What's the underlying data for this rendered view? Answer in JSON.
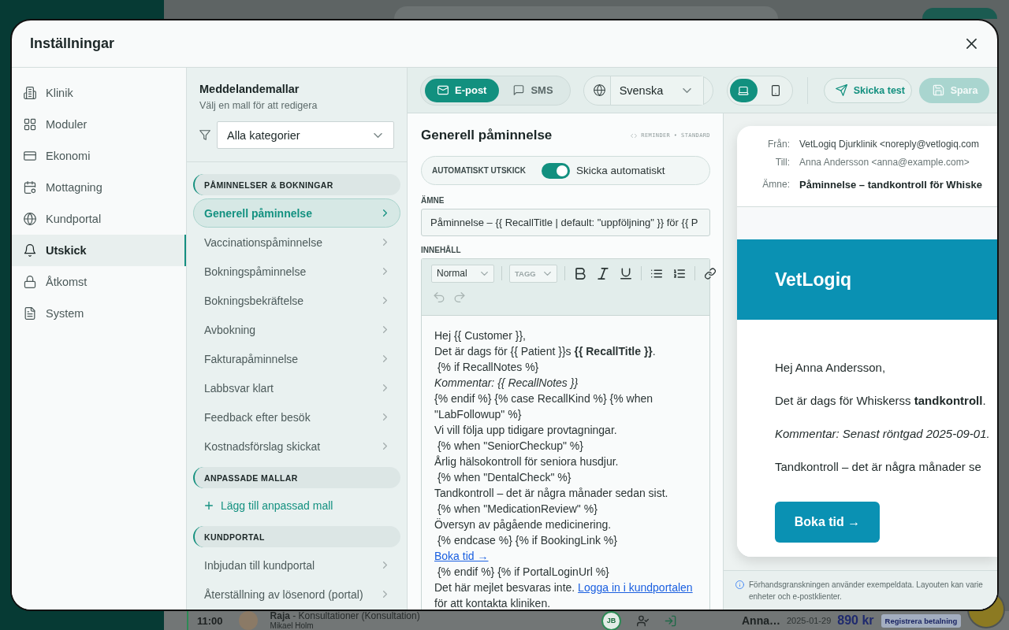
{
  "background": {
    "appointment": {
      "time": "11:00",
      "title": "**Raja** - Konsultationer (Konsultation)",
      "vet": "Mikael Holm",
      "initials": "JB"
    },
    "invoice": {
      "customer": "Anna…",
      "date": "2025-01-29",
      "amount": "890 kr",
      "action": "Registrera betalning"
    }
  },
  "dialog": {
    "title": "Inställningar"
  },
  "nav": {
    "items": [
      {
        "label": "Klinik",
        "selected": false
      },
      {
        "label": "Moduler",
        "selected": false
      },
      {
        "label": "Ekonomi",
        "selected": false
      },
      {
        "label": "Mottagning",
        "selected": false
      },
      {
        "label": "Kundportal",
        "selected": false
      },
      {
        "label": "Utskick",
        "selected": true
      },
      {
        "label": "Åtkomst",
        "selected": false
      },
      {
        "label": "System",
        "selected": false
      }
    ]
  },
  "templates": {
    "title": "Meddelandemallar",
    "subtitle": "Välj en mall för att redigera",
    "filter": {
      "value": "Alla kategorier"
    },
    "groups": [
      {
        "title": "PÅMINNELSER & BOKNINGAR",
        "items": [
          {
            "label": "Generell påminnelse",
            "selected": true
          },
          {
            "label": "Vaccinationspåminnelse",
            "selected": false
          },
          {
            "label": "Bokningspåminnelse",
            "selected": false
          },
          {
            "label": "Bokningsbekräftelse",
            "selected": false
          },
          {
            "label": "Avbokning",
            "selected": false
          },
          {
            "label": "Fakturapåminnelse",
            "selected": false
          },
          {
            "label": "Labbsvar klart",
            "selected": false
          },
          {
            "label": "Feedback efter besök",
            "selected": false
          },
          {
            "label": "Kostnadsförslag skickat",
            "selected": false
          }
        ]
      },
      {
        "title": "ANPASSADE MALLAR",
        "add_label": "Lägg till anpassad mall"
      },
      {
        "title": "KUNDPORTAL",
        "items": [
          {
            "label": "Inbjudan till kundportal",
            "selected": false
          },
          {
            "label": "Återställning av lösenord (portal)",
            "selected": false
          }
        ]
      }
    ]
  },
  "toolbar": {
    "channels": [
      {
        "label": "E-post",
        "selected": true
      },
      {
        "label": "SMS",
        "selected": false
      }
    ],
    "language": {
      "value": "Svenska"
    },
    "devices": [
      {
        "selected": true
      },
      {
        "selected": false
      }
    ],
    "actions": [
      {
        "kind": "test",
        "label": "Skicka test",
        "disabled": false
      },
      {
        "kind": "save",
        "label": "Spara",
        "disabled": true
      }
    ]
  },
  "editor": {
    "title": "Generell påminnelse",
    "meta": "REMINDER • STANDARD",
    "auto_send": {
      "label": "AUTOMATISKT UTSKICK",
      "toggle_label": "Skicka automatiskt",
      "on": true
    },
    "subject": {
      "label": "ÄMNE",
      "value": "Påminnelse – {{ RecallTitle | default: \"uppföljning\" }} för {{ P"
    },
    "content": {
      "label": "INNEHÅLL",
      "format": "Normal",
      "tag_placeholder": "TAGG",
      "undo_disabled": true,
      "redo_disabled": true,
      "lines": [
        {
          "kind": "text",
          "text": "Hej {{ Customer }},"
        },
        {
          "kind": "text",
          "text": "Det är dags för {{ Patient }}s **{{ RecallTitle }}**."
        },
        {
          "kind": "text",
          "text": " {% if RecallNotes %}"
        },
        {
          "kind": "italic",
          "text": "Kommentar: {{ RecallNotes }}"
        },
        {
          "kind": "text",
          "text": "{% endif %} {% case RecallKind %} {% when \"LabFollowup\" %}"
        },
        {
          "kind": "text",
          "text": "Vi vill följa upp tidigare provtagningar."
        },
        {
          "kind": "text",
          "text": " {% when \"SeniorCheckup\" %}"
        },
        {
          "kind": "text",
          "text": "Årlig hälsokontroll för seniora husdjur."
        },
        {
          "kind": "text",
          "text": " {% when \"DentalCheck\" %}"
        },
        {
          "kind": "text",
          "text": "Tandkontroll – det är några månader sedan sist."
        },
        {
          "kind": "text",
          "text": " {% when \"MedicationReview\" %}"
        },
        {
          "kind": "text",
          "text": "Översyn av pågående medicinering."
        },
        {
          "kind": "text",
          "text": " {% endcase %} {% if BookingLink %}"
        },
        {
          "kind": "link",
          "text": "Boka tid →"
        },
        {
          "kind": "text",
          "text": " {% endif %} {% if PortalLoginUrl %}"
        },
        {
          "kind": "linked",
          "before": "Det här mejlet besvaras inte.",
          "link": "Logga in i kundportalen",
          "after": "för att kontakta kliniken."
        }
      ]
    }
  },
  "preview": {
    "fields": [
      {
        "kind": "from",
        "label": "Från:",
        "value": "VetLogiq Djurklinik <noreply@vetlogiq.com"
      },
      {
        "kind": "to",
        "label": "Till:",
        "value": "Anna Andersson <anna@example.com>"
      },
      {
        "kind": "subject",
        "label": "Ämne:",
        "value": "Påminnelse – tandkontroll för Whiske"
      }
    ],
    "brand": "VetLogiq",
    "paragraphs": [
      {
        "kind": "text",
        "text": "Hej Anna Andersson,"
      },
      {
        "kind": "text",
        "text": "Det är dags för Whiskerss **tandkontroll**."
      },
      {
        "kind": "italic",
        "text": "Kommentar: Senast röntgad 2025-09-01."
      },
      {
        "kind": "text",
        "text": "Tandkontroll – det är några månader se"
      }
    ],
    "button": "Boka tid →",
    "note": [
      "Förhandsgranskningen använder exempeldata. Layouten kan varie",
      "enheter och e-postklienter."
    ]
  }
}
